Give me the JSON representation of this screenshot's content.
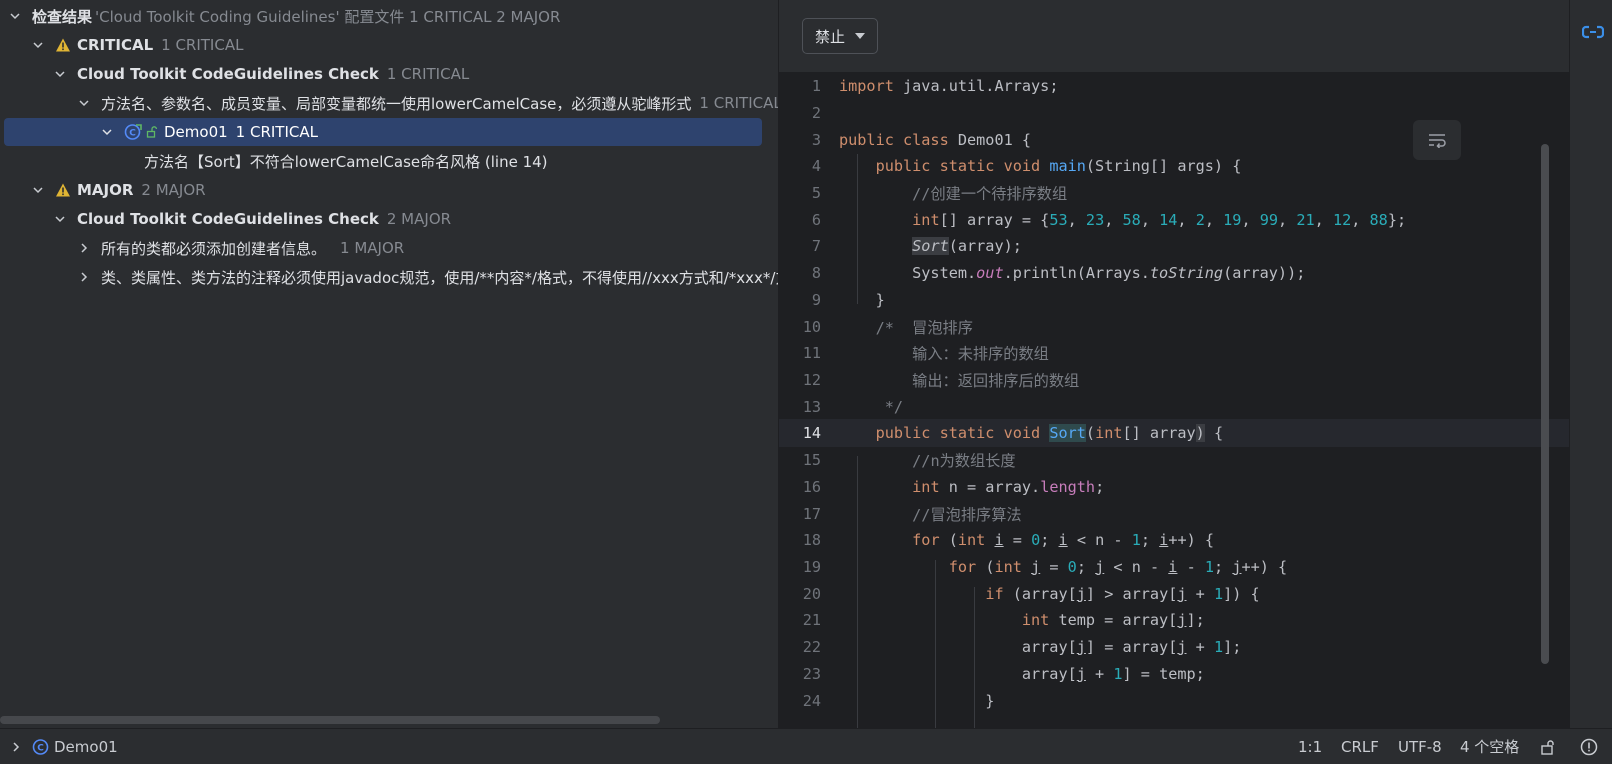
{
  "tree": {
    "root": {
      "label": "检查结果",
      "detail": "'Cloud Toolkit Coding Guidelines' 配置文件  1 CRITICAL 2 MAJOR"
    },
    "critical": {
      "label": "CRITICAL",
      "count": "1 CRITICAL"
    },
    "critical_check": {
      "label": "Cloud Toolkit CodeGuidelines Check",
      "count": "1 CRITICAL"
    },
    "critical_rule": {
      "label": "方法名、参数名、成员变量、局部变量都统一使用lowerCamelCase，必须遵从驼峰形式",
      "count": "1 CRITICAL"
    },
    "critical_file": {
      "label": "Demo01",
      "count": "1 CRITICAL"
    },
    "critical_problem": {
      "label": "方法名【Sort】不符合lowerCamelCase命名风格 (line 14)"
    },
    "major": {
      "label": "MAJOR",
      "count": "2 MAJOR"
    },
    "major_check": {
      "label": "Cloud Toolkit CodeGuidelines Check",
      "count": "2 MAJOR"
    },
    "major_rule1": {
      "label": "所有的类都必须添加创建者信息。",
      "count": "1 MAJOR"
    },
    "major_rule2": {
      "label": "类、类属性、类方法的注释必须使用javadoc规范，使用/**内容*/格式，不得使用//xxx方式和/*xxx*/方"
    }
  },
  "editor": {
    "toggle_label": "禁止",
    "line_numbers": [
      "1",
      "2",
      "3",
      "4",
      "5",
      "6",
      "7",
      "8",
      "9",
      "10",
      "11",
      "12",
      "13",
      "14",
      "15",
      "16",
      "17",
      "18",
      "19",
      "20",
      "21",
      "22",
      "23",
      "24"
    ],
    "current_line": 14
  },
  "status_bar": {
    "file": "Demo01",
    "position": "1:1",
    "line_ending": "CRLF",
    "encoding": "UTF-8",
    "indent": "4 个空格"
  },
  "colors": {
    "accent_selection": "#2e436e",
    "warning": "#e0b534",
    "keyword": "#cf8e6d",
    "number": "#2aacb8",
    "function": "#56a8f5"
  },
  "icons": {
    "tree_chevron": "chevron-down-icon",
    "severity": "warning-icon",
    "file": "class-run-icon",
    "soft_wrap": "soft-wrap-icon",
    "right_toolbar": "cloud-toolkit-icon",
    "status_lock": "lock-icon",
    "status_notifications": "notification-icon"
  }
}
